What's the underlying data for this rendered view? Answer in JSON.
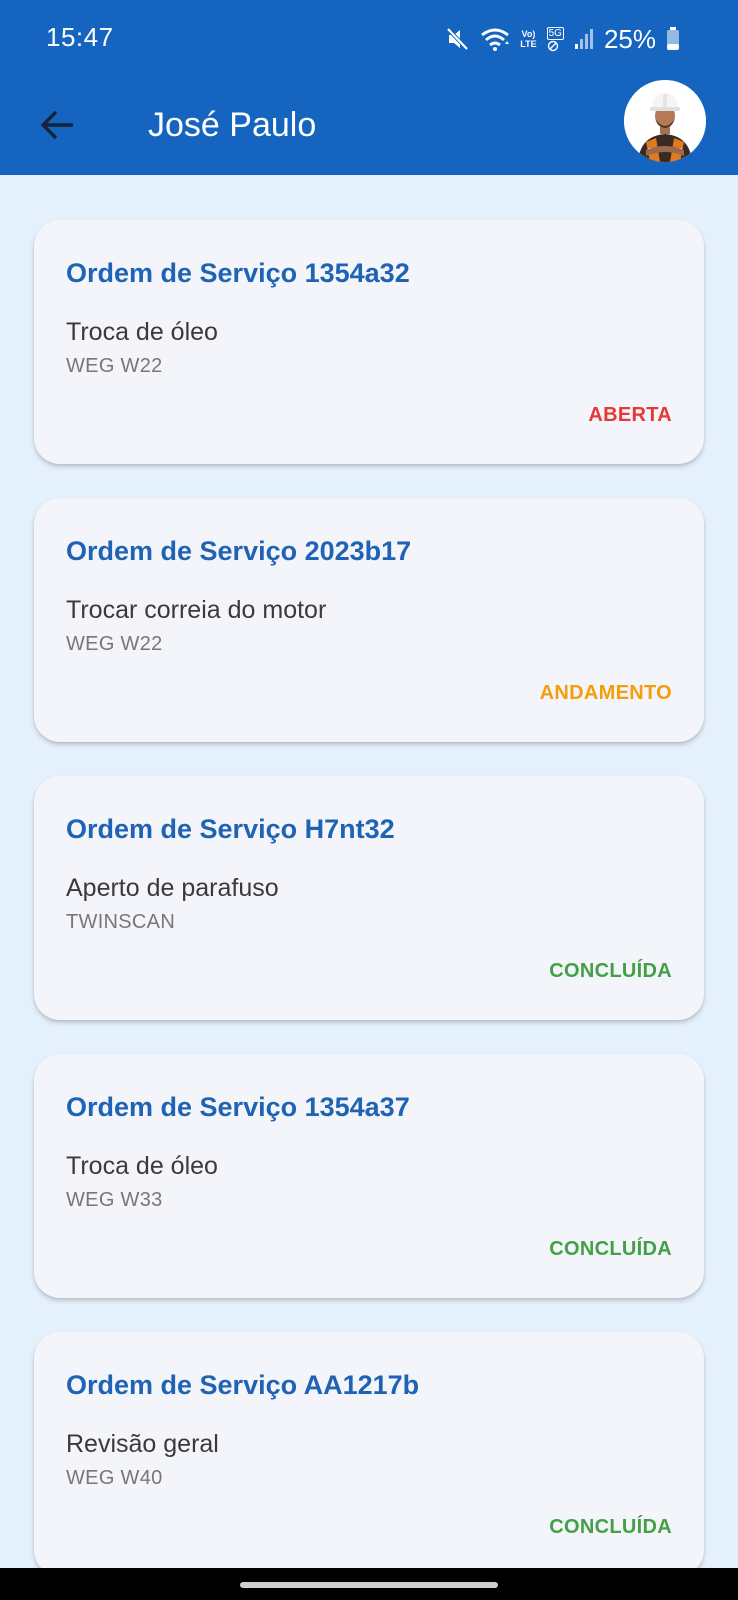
{
  "status_bar": {
    "time": "15:47",
    "lte_top": "Vo)",
    "lte_bottom": "LTE",
    "fiveg": "5G",
    "battery": "25%",
    "icons": [
      "mute-icon",
      "wifi-icon",
      "volte-icon",
      "5g-icon",
      "signal-icon",
      "battery-icon"
    ]
  },
  "app_bar": {
    "title": "José Paulo",
    "back_icon": "arrow-back-icon",
    "avatar_icon": "worker-avatar"
  },
  "colors": {
    "primary": "#1565c0",
    "background": "#e4f0fb",
    "card": "#f4f5fa",
    "title": "#1e63b4",
    "status_aberta": "#e53935",
    "status_andamento": "#f59e0b",
    "status_concluida": "#43a047"
  },
  "orders": [
    {
      "title": "Ordem de Serviço 1354a32",
      "description": "Troca de óleo",
      "equipment": "WEG W22",
      "status": "ABERTA",
      "status_color": "#e53935"
    },
    {
      "title": "Ordem de Serviço 2023b17",
      "description": "Trocar correia do motor",
      "equipment": "WEG W22",
      "status": "ANDAMENTO",
      "status_color": "#f59e0b"
    },
    {
      "title": "Ordem de Serviço H7nt32",
      "description": "Aperto de parafuso",
      "equipment": "TWINSCAN",
      "status": "CONCLUÍDA",
      "status_color": "#43a047"
    },
    {
      "title": "Ordem de Serviço 1354a37",
      "description": "Troca de óleo",
      "equipment": "WEG W33",
      "status": "CONCLUÍDA",
      "status_color": "#43a047"
    },
    {
      "title": "Ordem de Serviço AA1217b",
      "description": "Revisão geral",
      "equipment": "WEG W40",
      "status": "CONCLUÍDA",
      "status_color": "#43a047"
    }
  ]
}
